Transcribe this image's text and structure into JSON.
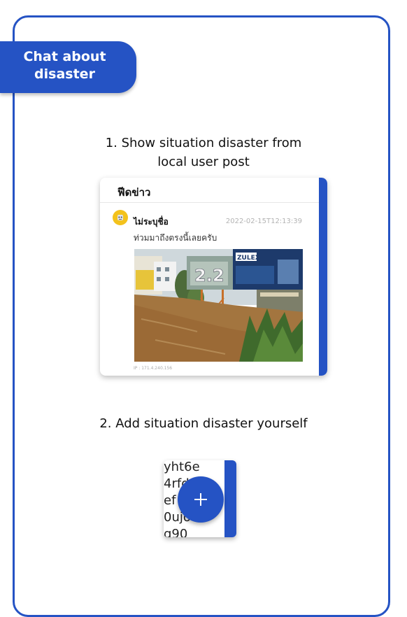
{
  "section_tab": {
    "line1": "Chat about",
    "line2": "disaster"
  },
  "step1": {
    "line1": "1. Show situation disaster from",
    "line2": "local user post"
  },
  "feed_card": {
    "header": "ฟีดข่าว",
    "post": {
      "username": "ไม่ระบุชื่อ",
      "timestamp": "2022-02-15T12:13:39",
      "message": "ท่วมมาถึงตรงนี้เลยครับ",
      "ip": "IP : 171.4.240.156",
      "billboard_text": "ZULEX",
      "billboard_numbers": "2.2"
    }
  },
  "step2": {
    "line1": "2. Add situation disaster yourself"
  },
  "fab_preview": {
    "lines": [
      "yht6e",
      "4rfd",
      "ef",
      "0ujo",
      "g90"
    ],
    "icon": "plus-icon"
  },
  "colors": {
    "accent": "#2553c4",
    "avatar": "#f3c21c"
  }
}
